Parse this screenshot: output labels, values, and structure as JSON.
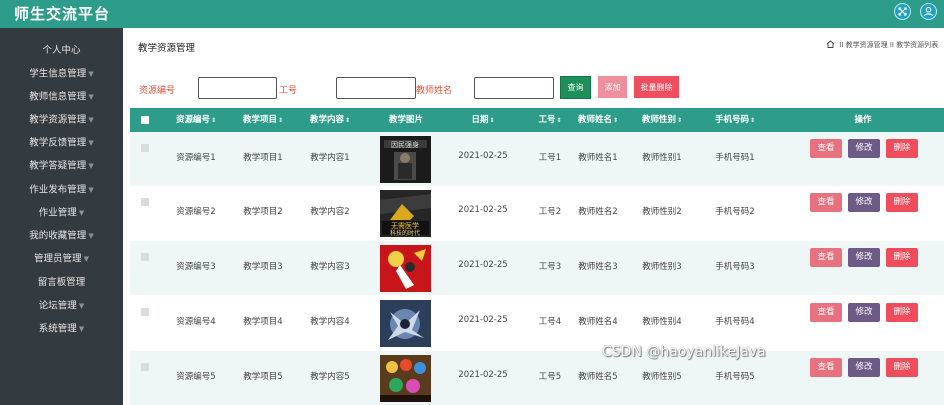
{
  "app": {
    "title": "师生交流平台"
  },
  "header_icons": [
    {
      "name": "fullscreen-icon"
    },
    {
      "name": "user-icon"
    }
  ],
  "sidebar": {
    "items": [
      {
        "label": "个人中心",
        "caret": false
      },
      {
        "label": "学生信息管理",
        "caret": true
      },
      {
        "label": "教师信息管理",
        "caret": true
      },
      {
        "label": "教学资源管理",
        "caret": true
      },
      {
        "label": "教学反馈管理",
        "caret": true
      },
      {
        "label": "教学答疑管理",
        "caret": true
      },
      {
        "label": "作业发布管理",
        "caret": true
      },
      {
        "label": "作业管理",
        "caret": true
      },
      {
        "label": "我的收藏管理",
        "caret": true
      },
      {
        "label": "管理员管理",
        "caret": true
      },
      {
        "label": "留言板管理",
        "caret": false
      },
      {
        "label": "论坛管理",
        "caret": true
      },
      {
        "label": "系统管理",
        "caret": true
      }
    ],
    "caret_glyph": "▼"
  },
  "page": {
    "title": "教学资源管理",
    "breadcrumb": [
      "教学资源管理",
      "教学资源列表"
    ],
    "breadcrumb_sep": " II "
  },
  "search": {
    "fields": [
      {
        "label": "资源编号",
        "value": ""
      },
      {
        "label": "工号",
        "value": ""
      },
      {
        "label": "教师姓名",
        "value": ""
      }
    ],
    "query_button": "查询",
    "add_button": "添加",
    "batch_delete_button": "批量删除"
  },
  "table": {
    "sort_glyph": "⇕",
    "columns": [
      {
        "label": "资源编号",
        "sortable": true
      },
      {
        "label": "教学项目",
        "sortable": true
      },
      {
        "label": "教学内容",
        "sortable": true
      },
      {
        "label": "教学图片",
        "sortable": false
      },
      {
        "label": "日期",
        "sortable": true
      },
      {
        "label": "工号",
        "sortable": true
      },
      {
        "label": "教师姓名",
        "sortable": true
      },
      {
        "label": "教师性别",
        "sortable": true
      },
      {
        "label": "手机号码",
        "sortable": true
      },
      {
        "label": "操作",
        "sortable": false
      }
    ],
    "rows": [
      {
        "resource_no": "资源编号1",
        "project": "教学项目1",
        "content": "教学内容1",
        "image": "book-cover-1",
        "date": "2021-02-25",
        "staff_no": "工号1",
        "teacher": "教师姓名1",
        "gender": "教师性别1",
        "phone": "手机号码1"
      },
      {
        "resource_no": "资源编号2",
        "project": "教学项目2",
        "content": "教学内容2",
        "image": "book-cover-2",
        "date": "2021-02-25",
        "staff_no": "工号2",
        "teacher": "教师姓名2",
        "gender": "教师性别2",
        "phone": "手机号码2"
      },
      {
        "resource_no": "资源编号3",
        "project": "教学项目3",
        "content": "教学内容3",
        "image": "anime-red-1",
        "date": "2021-02-25",
        "staff_no": "工号3",
        "teacher": "教师姓名3",
        "gender": "教师性别3",
        "phone": "手机号码3"
      },
      {
        "resource_no": "资源编号4",
        "project": "教学项目4",
        "content": "教学内容4",
        "image": "anime-blue-1",
        "date": "2021-02-25",
        "staff_no": "工号4",
        "teacher": "教师姓名4",
        "gender": "教师性别4",
        "phone": "手机号码4"
      },
      {
        "resource_no": "资源编号5",
        "project": "教学项目5",
        "content": "教学内容5",
        "image": "anime-group-1",
        "date": "2021-02-25",
        "staff_no": "工号5",
        "teacher": "教师姓名5",
        "gender": "教师性别5",
        "phone": "手机号码5"
      }
    ],
    "row_actions": {
      "view": "查看",
      "edit": "修改",
      "delete": "删除"
    }
  },
  "watermark": "CSDN @haoyanlikeJava",
  "colors": {
    "primary": "#2e9c8a",
    "sidebar_bg": "#333a40",
    "label_red": "#e0533a",
    "query_btn": "#1f8f5a",
    "add_btn": "#ee8f9c",
    "batch_delete_btn": "#ee4e5e",
    "view_btn": "#e8717f",
    "edit_btn": "#6d5a87",
    "delete_btn": "#ef4c5c",
    "row_alt": "#eef7f5"
  }
}
